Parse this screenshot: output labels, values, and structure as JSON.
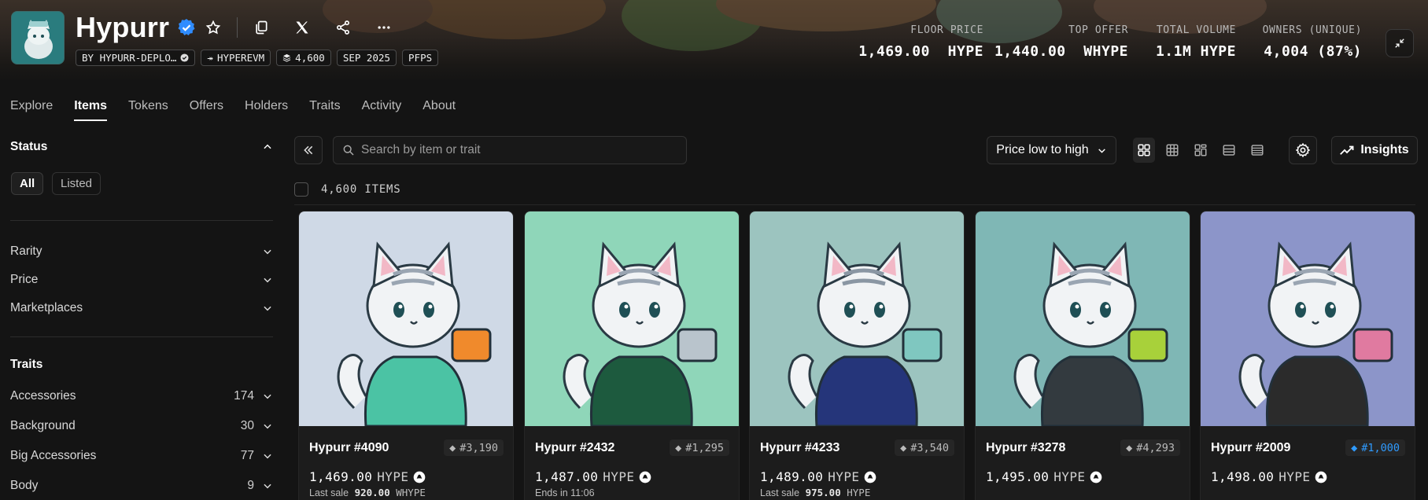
{
  "collection": {
    "title": "Hypurr",
    "chips": [
      {
        "icon": "creator-icon",
        "label": "BY HYPURR-DEPLO…"
      },
      {
        "icon": "chain-arrow-icon",
        "label": "HYPEREVM"
      },
      {
        "icon": "layers-icon",
        "label": "4,600"
      },
      {
        "icon": "calendar-icon",
        "label": "SEP 2025"
      },
      {
        "icon": "none",
        "label": "PFPS"
      }
    ]
  },
  "stats": [
    {
      "label": "FLOOR PRICE",
      "value": "1,469.00  HYPE"
    },
    {
      "label": "TOP OFFER",
      "value": "1,440.00  WHYPE"
    },
    {
      "label": "TOTAL VOLUME",
      "value": "1.1M HYPE"
    },
    {
      "label": "OWNERS (UNIQUE)",
      "value": "4,004 (87%)"
    }
  ],
  "tabs": [
    "Explore",
    "Items",
    "Tokens",
    "Offers",
    "Holders",
    "Traits",
    "Activity",
    "About"
  ],
  "active_tab": "Items",
  "sidebar": {
    "status_title": "Status",
    "status_options": [
      "All",
      "Listed"
    ],
    "filters": [
      "Rarity",
      "Price",
      "Marketplaces"
    ],
    "traits_title": "Traits",
    "traits": [
      {
        "label": "Accessories",
        "count": "174"
      },
      {
        "label": "Background",
        "count": "30"
      },
      {
        "label": "Big Accessories",
        "count": "77"
      },
      {
        "label": "Body",
        "count": "9"
      }
    ]
  },
  "toolbar": {
    "search_placeholder": "Search by item or trait",
    "sort_label": "Price low to high",
    "insights_label": "Insights",
    "item_count": "4,600 ITEMS"
  },
  "items": [
    {
      "name": "Hypurr #4090",
      "rank": "#3,190",
      "highlight": false,
      "price": "1,469.00",
      "currency": "HYPE",
      "sub_prefix": "Last sale",
      "sub_value": "920.00",
      "sub_suffix": "WHYPE",
      "bg": "#cfd9e6"
    },
    {
      "name": "Hypurr #2432",
      "rank": "#1,295",
      "highlight": false,
      "price": "1,487.00",
      "currency": "HYPE",
      "sub_prefix": "Ends in 11:06",
      "sub_value": "",
      "sub_suffix": "",
      "bg": "#8fd6b9"
    },
    {
      "name": "Hypurr #4233",
      "rank": "#3,540",
      "highlight": false,
      "price": "1,489.00",
      "currency": "HYPE",
      "sub_prefix": "Last sale",
      "sub_value": "975.00",
      "sub_suffix": "HYPE",
      "bg": "#9cc4bf"
    },
    {
      "name": "Hypurr #3278",
      "rank": "#4,293",
      "highlight": false,
      "price": "1,495.00",
      "currency": "HYPE",
      "sub_prefix": "",
      "sub_value": "",
      "sub_suffix": "",
      "bg": "#7fb7b5"
    },
    {
      "name": "Hypurr #2009",
      "rank": "#1,000",
      "highlight": true,
      "price": "1,498.00",
      "currency": "HYPE",
      "sub_prefix": "",
      "sub_value": "",
      "sub_suffix": "",
      "bg": "#8c95c9"
    }
  ]
}
